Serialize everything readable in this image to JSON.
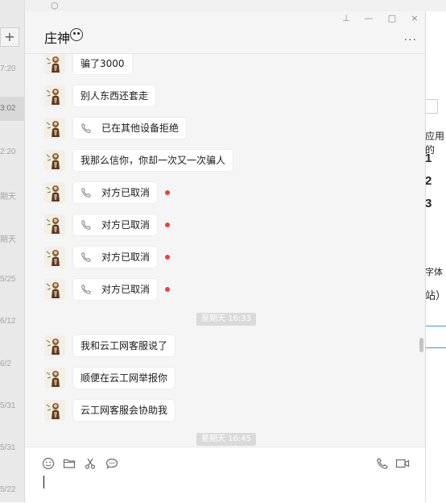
{
  "background_app": {
    "list_times": [
      "7:20",
      "3:02",
      "2:20",
      "期天",
      "期天",
      "5/25",
      "6/12",
      "6/2",
      "5/31",
      "5/31",
      "5/22"
    ],
    "doc_fragments": {
      "apply_text": "应用的",
      "numbers": [
        "1",
        "2",
        "3"
      ],
      "font_text": "字体",
      "site_text": "站）"
    }
  },
  "chat": {
    "title": "庄神",
    "window_controls": {
      "pin": "⊥",
      "minimize": "—",
      "maximize": "□",
      "close": "×"
    },
    "more_label": "···",
    "messages": [
      {
        "text": "骗了3000",
        "call": false,
        "unread": false
      },
      {
        "text": "别人东西还套走",
        "call": false,
        "unread": false
      },
      {
        "text": "已在其他设备拒绝",
        "call": true,
        "unread": false
      },
      {
        "text": "我那么信你，你却一次又一次骗人",
        "call": false,
        "unread": false
      },
      {
        "text": "对方已取消",
        "call": true,
        "unread": true
      },
      {
        "text": "对方已取消",
        "call": true,
        "unread": true
      },
      {
        "text": "对方已取消",
        "call": true,
        "unread": true
      },
      {
        "text": "对方已取消",
        "call": true,
        "unread": true
      },
      {
        "timestamp": "星期天 16:33"
      },
      {
        "text": "我和云工网客服说了",
        "call": false,
        "unread": false
      },
      {
        "text": "顺便在云工网举报你",
        "call": false,
        "unread": false
      },
      {
        "text": "云工网客服会协助我",
        "call": false,
        "unread": false
      },
      {
        "timestamp": "星期天 16:45"
      }
    ],
    "toolbar": {
      "left": [
        "emoji-icon",
        "folder-icon",
        "scissors-icon",
        "chat-bubble-icon"
      ],
      "right": [
        "phone-call-icon",
        "video-call-icon"
      ]
    },
    "input_value": ""
  }
}
